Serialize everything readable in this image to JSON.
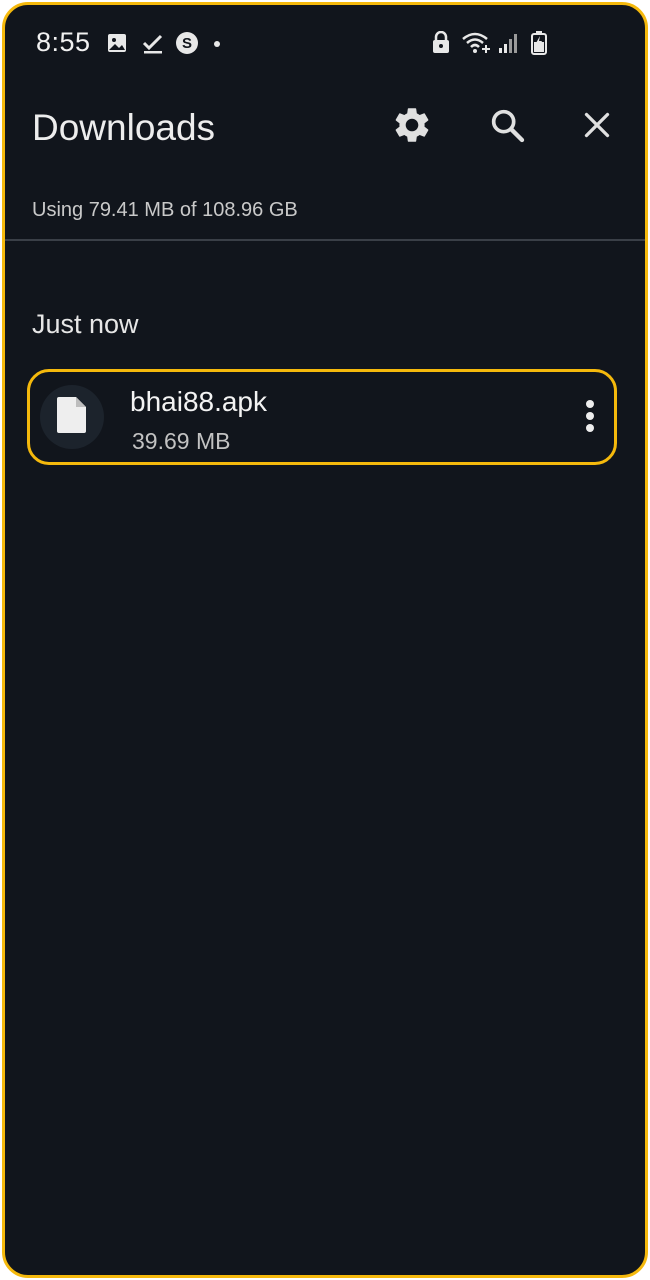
{
  "status_bar": {
    "time": "8:55",
    "left_icons": [
      "gallery-icon",
      "check-icon",
      "skype-icon",
      "dot-icon"
    ],
    "right_icons": [
      "lock-icon",
      "wifi-plus-icon",
      "signal-icon",
      "battery-icon"
    ]
  },
  "toolbar": {
    "title": "Downloads",
    "buttons": [
      "settings-icon",
      "search-icon",
      "close-icon"
    ]
  },
  "storage": {
    "usage_text": "Using 79.41 MB of 108.96 GB"
  },
  "downloads": {
    "section_header": "Just now",
    "items": [
      {
        "file_name": "bhai88.apk",
        "file_size": "39.69 MB",
        "icon": "file-icon",
        "menu_icon": "more-vert-icon"
      }
    ]
  },
  "colors": {
    "background": "#11151c",
    "highlight_border": "#f5b90c",
    "text_primary": "#ededed",
    "text_secondary": "#c2c2c2",
    "divider": "#3a3f47"
  }
}
